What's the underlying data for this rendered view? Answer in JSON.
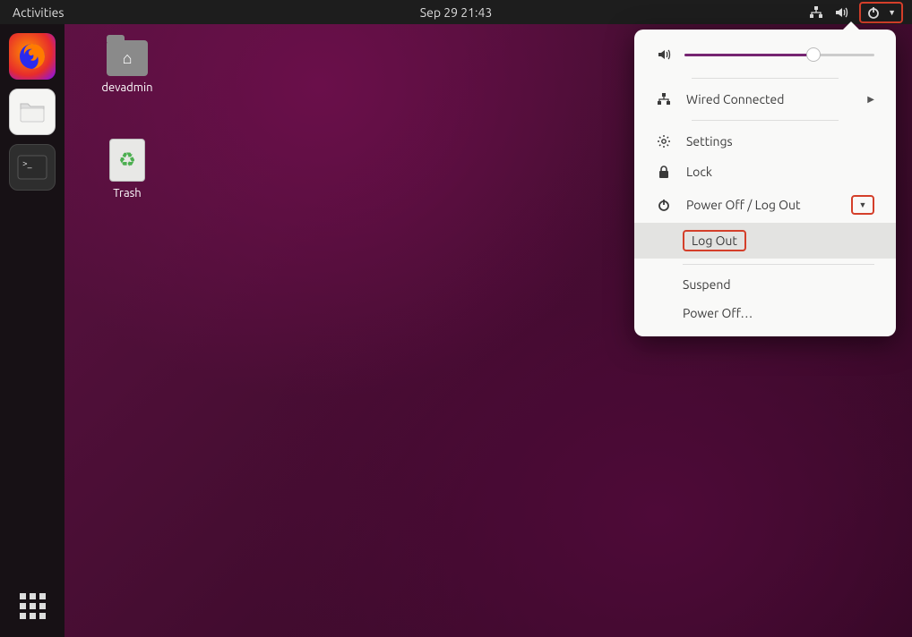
{
  "topbar": {
    "activities": "Activities",
    "clock": "Sep 29  21:43"
  },
  "desktop_icons": {
    "home_label": "devadmin",
    "trash_label": "Trash"
  },
  "system_menu": {
    "volume_percent": 68,
    "wired": "Wired Connected",
    "settings": "Settings",
    "lock": "Lock",
    "power_section": "Power Off / Log Out",
    "logout": "Log Out",
    "suspend": "Suspend",
    "poweroff": "Power Off…"
  }
}
